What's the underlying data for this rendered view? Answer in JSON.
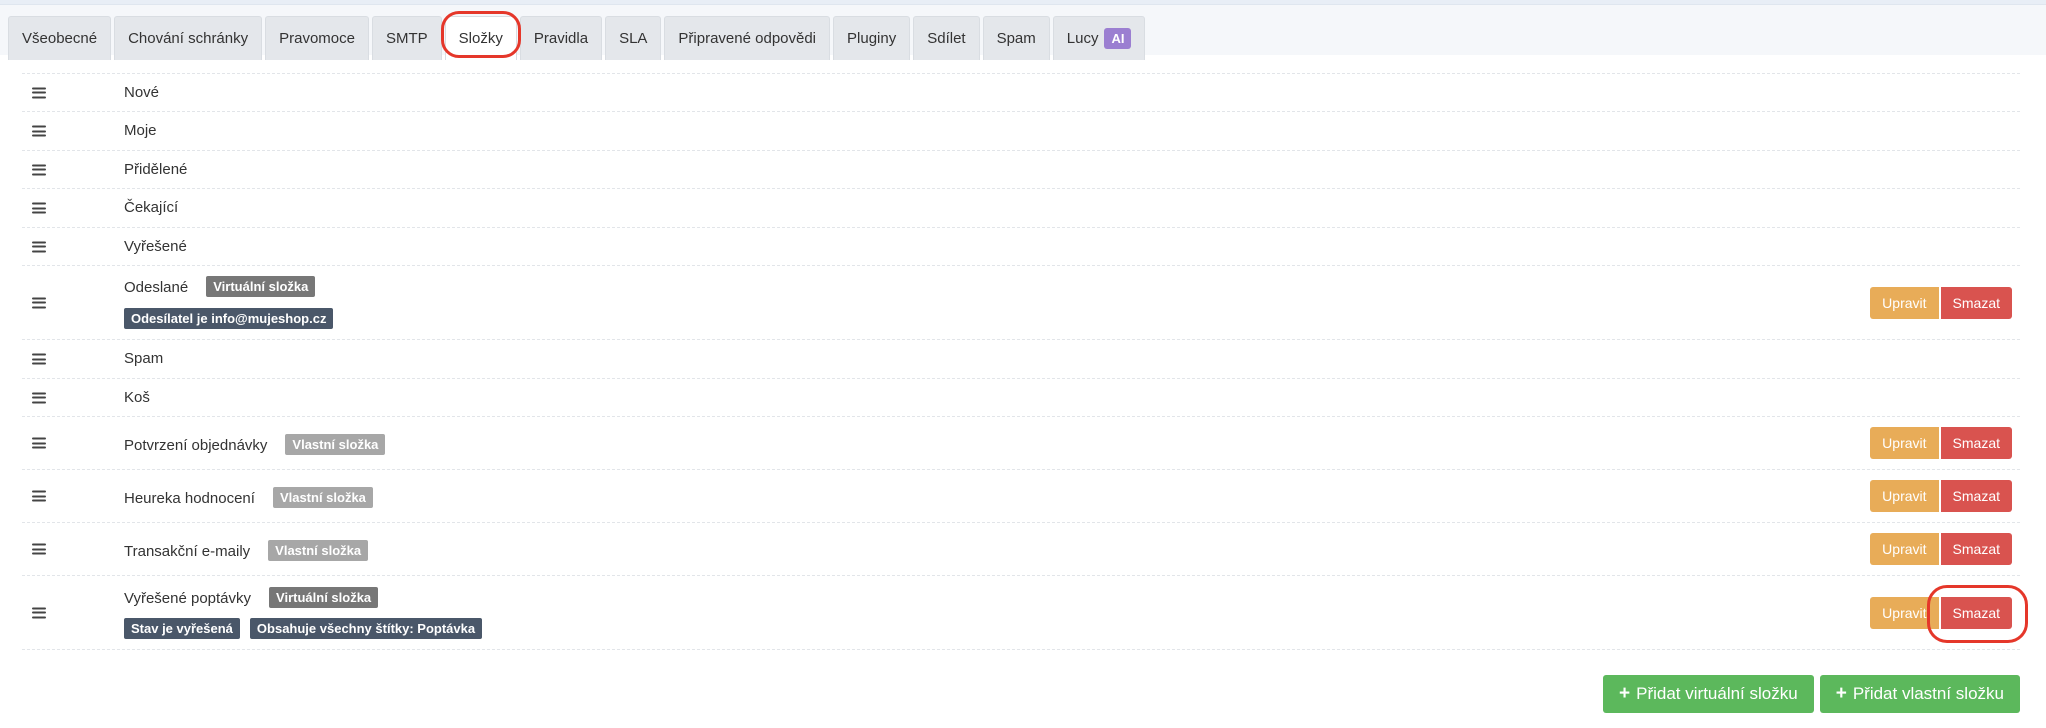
{
  "tabs": [
    {
      "label": "Všeobecné"
    },
    {
      "label": "Chování schránky"
    },
    {
      "label": "Pravomoce"
    },
    {
      "label": "SMTP"
    },
    {
      "label": "Složky"
    },
    {
      "label": "Pravidla"
    },
    {
      "label": "SLA"
    },
    {
      "label": "Připravené odpovědi"
    },
    {
      "label": "Pluginy"
    },
    {
      "label": "Sdílet"
    },
    {
      "label": "Spam"
    },
    {
      "label": "Lucy",
      "badge": "AI"
    }
  ],
  "active_tab": "Složky",
  "folders": [
    {
      "name": "Nové"
    },
    {
      "name": "Moje"
    },
    {
      "name": "Přidělené"
    },
    {
      "name": "Čekající"
    },
    {
      "name": "Vyřešené"
    },
    {
      "name": "Odeslané",
      "type_badge": "Virtuální složka",
      "conditions": [
        "Odesílatel je info@mujeshop.cz"
      ]
    },
    {
      "name": "Spam"
    },
    {
      "name": "Koš"
    },
    {
      "name": "Potvrzení objednávky",
      "type_badge": "Vlastní složka"
    },
    {
      "name": "Heureka hodnocení",
      "type_badge": "Vlastní složka"
    },
    {
      "name": "Transakční e-maily",
      "type_badge": "Vlastní složka"
    },
    {
      "name": "Vyřešené poptávky",
      "type_badge": "Virtuální složka",
      "conditions": [
        "Stav je vyřešená",
        "Obsahuje všechny štítky: Poptávka"
      ]
    }
  ],
  "buttons": {
    "edit_label": "Upravit",
    "delete_label": "Smazat",
    "add_virtual_label": "Přidat virtuální složku",
    "add_own_label": "Přidat vlastní složku",
    "plus": "+"
  },
  "colors": {
    "edit": "#e8ac58",
    "delete": "#d9534f",
    "add": "#5cb85c",
    "highlight": "#e5372a",
    "condition_badge": "#4a5769"
  },
  "icons": {
    "drag_handle": "hamburger-icon",
    "add": "plus-icon"
  }
}
